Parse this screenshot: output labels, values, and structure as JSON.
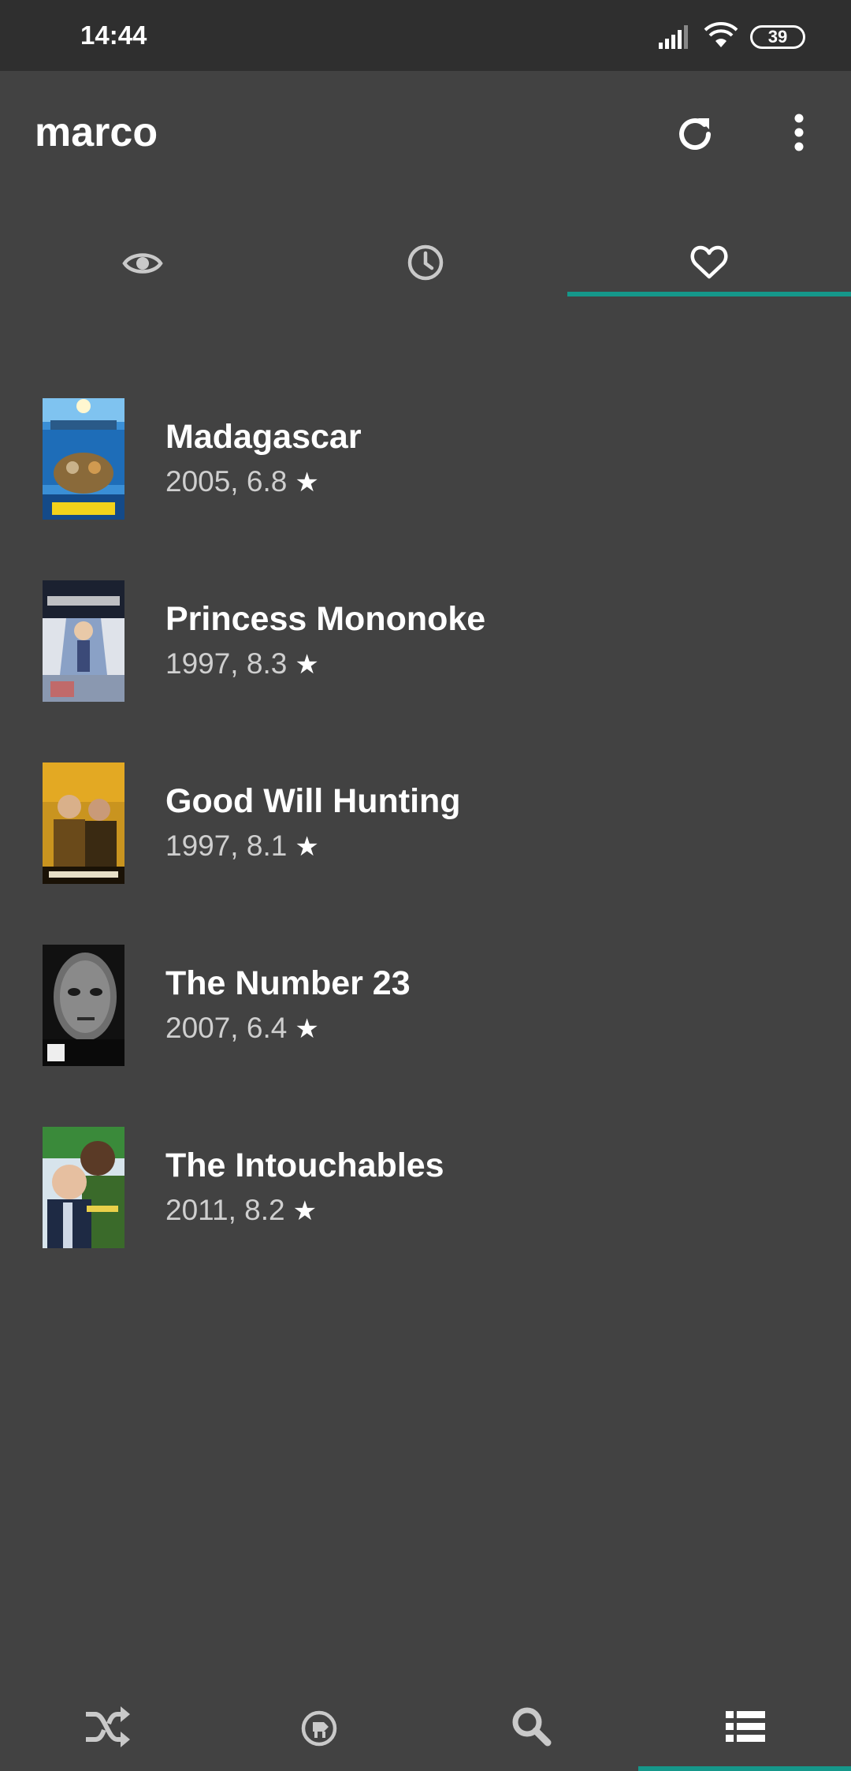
{
  "status_bar": {
    "time": "14:44",
    "battery": "39"
  },
  "app_bar": {
    "title": "marco",
    "refresh_icon": "refresh-icon",
    "more_icon": "more-vert-icon"
  },
  "tabs": [
    {
      "icon": "eye-icon",
      "selected": false
    },
    {
      "icon": "clock-icon",
      "selected": false
    },
    {
      "icon": "heart-icon",
      "selected": true
    }
  ],
  "movies": [
    {
      "title": "Madagascar",
      "year": "2005",
      "rating": "6.8",
      "meta": "2005, 6.8"
    },
    {
      "title": "Princess Mononoke",
      "year": "1997",
      "rating": "8.3",
      "meta": "1997, 8.3"
    },
    {
      "title": "Good Will Hunting",
      "year": "1997",
      "rating": "8.1",
      "meta": "1997, 8.1"
    },
    {
      "title": "The Number 23",
      "year": "2007",
      "rating": "6.4",
      "meta": "2007, 6.4"
    },
    {
      "title": "The Intouchables",
      "year": "2011",
      "rating": "8.2",
      "meta": "2011, 8.2"
    }
  ],
  "bottom_nav": [
    {
      "icon": "shuffle-icon",
      "selected": false
    },
    {
      "icon": "explore-icon",
      "selected": false
    },
    {
      "icon": "search-icon",
      "selected": false
    },
    {
      "icon": "list-icon",
      "selected": true
    }
  ],
  "colors": {
    "background": "#424242",
    "status_bar": "#2f2f2f",
    "accent": "#15978a",
    "text_primary": "#ffffff",
    "text_secondary": "#cfcfcf"
  }
}
